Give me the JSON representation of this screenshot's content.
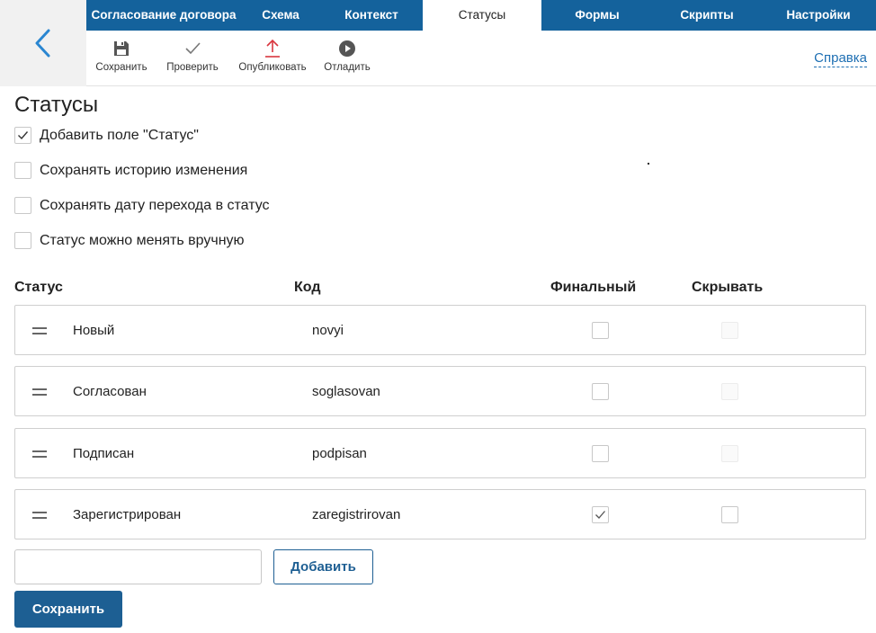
{
  "tabs": [
    {
      "label": "Согласование договора",
      "active": false
    },
    {
      "label": "Схема",
      "active": false
    },
    {
      "label": "Контекст",
      "active": false
    },
    {
      "label": "Статусы",
      "active": true
    },
    {
      "label": "Формы",
      "active": false
    },
    {
      "label": "Скрипты",
      "active": false
    },
    {
      "label": "Настройки",
      "active": false
    }
  ],
  "toolbar": {
    "save_label": "Сохранить",
    "check_label": "Проверить",
    "publish_label": "Опубликовать",
    "debug_label": "Отладить",
    "help_label": "Справка"
  },
  "page": {
    "title": "Статусы",
    "options": [
      {
        "label": "Добавить поле \"Статус\"",
        "checked": true
      },
      {
        "label": "Сохранять историю изменения",
        "checked": false
      },
      {
        "label": "Сохранять дату перехода в статус",
        "checked": false
      },
      {
        "label": "Статус можно менять вручную",
        "checked": false
      }
    ]
  },
  "table": {
    "headers": {
      "status": "Статус",
      "code": "Код",
      "final": "Финальный",
      "hide": "Скрывать"
    },
    "rows": [
      {
        "name": "Новый",
        "code": "novyi",
        "final": false,
        "hide": false,
        "hide_disabled": true
      },
      {
        "name": "Согласован",
        "code": "soglasovan",
        "final": false,
        "hide": false,
        "hide_disabled": true
      },
      {
        "name": "Подписан",
        "code": "podpisan",
        "final": false,
        "hide": false,
        "hide_disabled": true
      },
      {
        "name": "Зарегистрирован",
        "code": "zaregistrirovan",
        "final": true,
        "hide": false,
        "hide_disabled": false
      }
    ]
  },
  "new_status": {
    "value": "",
    "placeholder": ""
  },
  "buttons": {
    "add_label": "Добавить",
    "save_label": "Сохранить"
  },
  "colors": {
    "primary": "#14629c",
    "accent_link": "#1e6fb3",
    "publish_icon": "#d9363e"
  },
  "icons": {
    "back": "chevron-left-icon",
    "save": "floppy-disk-icon",
    "check": "checkmark-icon",
    "publish": "upload-arrow-icon",
    "debug": "play-circle-icon",
    "drag": "drag-handle-icon"
  }
}
